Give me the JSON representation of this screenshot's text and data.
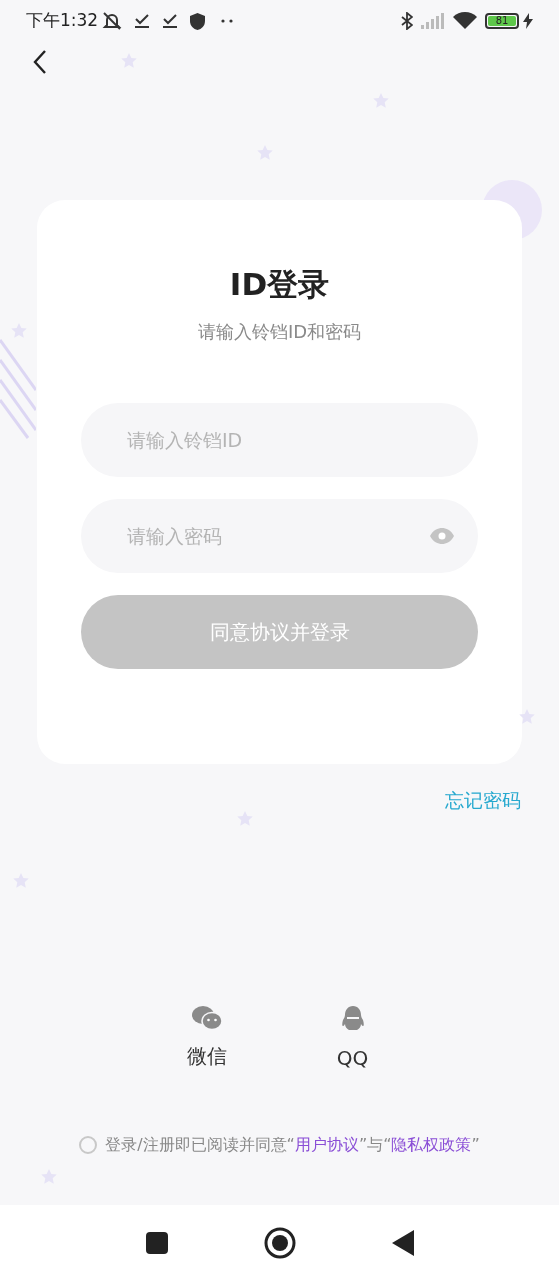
{
  "status_bar": {
    "time": "下午1:32",
    "battery": "81"
  },
  "card": {
    "title": "ID登录",
    "subtitle": "请输入铃铛ID和密码",
    "fields": [
      {
        "kind": "text",
        "placeholder": "请输入铃铛ID"
      },
      {
        "kind": "password",
        "placeholder": "请输入密码"
      }
    ],
    "submit": {
      "label": "同意协议并登录",
      "disabled": true
    }
  },
  "forgot_password": "忘记密码",
  "social_logins": [
    {
      "kind": "wechat",
      "label": "微信"
    },
    {
      "kind": "qq",
      "label": "QQ"
    }
  ],
  "agreement": {
    "checked": false,
    "parts": [
      {
        "kind": "text",
        "text": "登录/注册即已阅读并同意“"
      },
      {
        "kind": "link",
        "text": "用户协议"
      },
      {
        "kind": "text",
        "text": "”与“"
      },
      {
        "kind": "link",
        "text": "隐私权政策"
      },
      {
        "kind": "text",
        "text": "”"
      }
    ]
  }
}
